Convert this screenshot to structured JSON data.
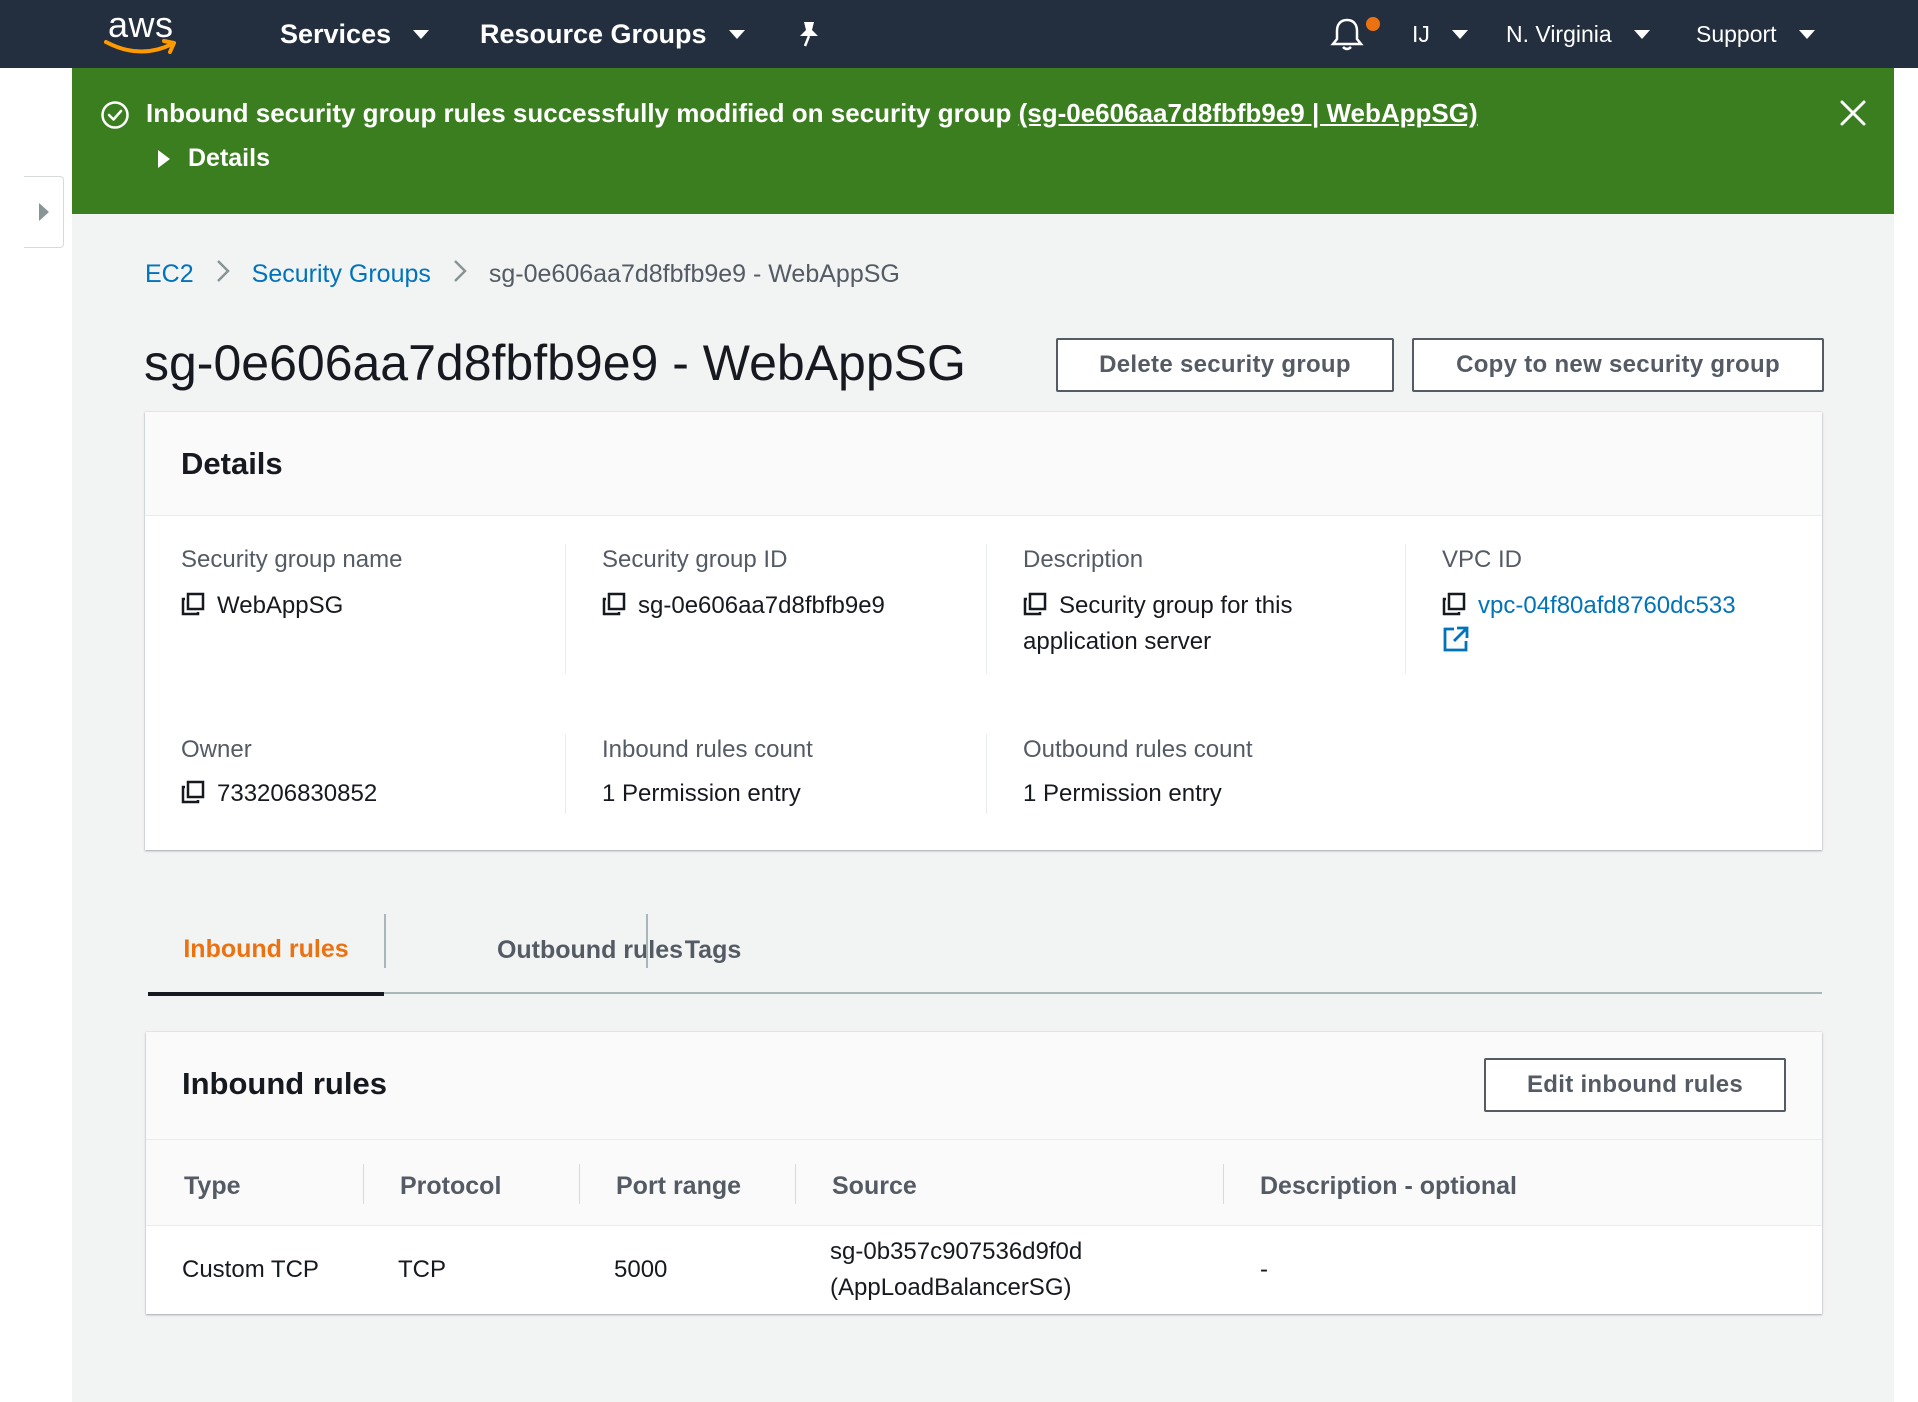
{
  "nav": {
    "logo": "aws",
    "services": "Services",
    "resource_groups": "Resource Groups",
    "pin_icon": "pin-icon",
    "bell_icon": "bell-icon",
    "account": "IJ",
    "region": "N. Virginia",
    "support": "Support"
  },
  "flash": {
    "message": "Inbound security group rules successfully modified on security group ",
    "link": "(sg-0e606aa7d8fbfb9e9 | WebAppSG)",
    "details": "Details",
    "color": "#3b7e1f"
  },
  "breadcrumb": {
    "items": [
      "EC2",
      "Security Groups"
    ],
    "current": "sg-0e606aa7d8fbfb9e9 - WebAppSG"
  },
  "page": {
    "title": "sg-0e606aa7d8fbfb9e9 - WebAppSG",
    "delete_button": "Delete security group",
    "copy_button": "Copy to new security group"
  },
  "details": {
    "title": "Details",
    "fields": [
      {
        "label": "Security group name",
        "value": "WebAppSG"
      },
      {
        "label": "Security group ID",
        "value": "sg-0e606aa7d8fbfb9e9"
      },
      {
        "label": "Description",
        "value": "Security group for this application server"
      },
      {
        "label": "VPC ID",
        "value": "vpc-04f80afd8760dc533"
      },
      {
        "label": "Owner",
        "value": "733206830852"
      },
      {
        "label": "Inbound rules count",
        "value": "1 Permission entry"
      },
      {
        "label": "Outbound rules count",
        "value": "1 Permission entry"
      }
    ]
  },
  "tabs": [
    "Inbound rules",
    "Outbound rules",
    "Tags"
  ],
  "inbound": {
    "title": "Inbound rules",
    "edit_button": "Edit inbound rules",
    "columns": [
      "Type",
      "Protocol",
      "Port range",
      "Source",
      "Description - optional"
    ],
    "rows": [
      [
        "Custom TCP",
        "TCP",
        "5000",
        "sg-0b357c907536d9f0d (AppLoadBalancerSG)",
        "-"
      ]
    ]
  },
  "colors": {
    "accent": "#ec7211",
    "link": "#0073bb",
    "nav_bg": "#232f3e"
  }
}
